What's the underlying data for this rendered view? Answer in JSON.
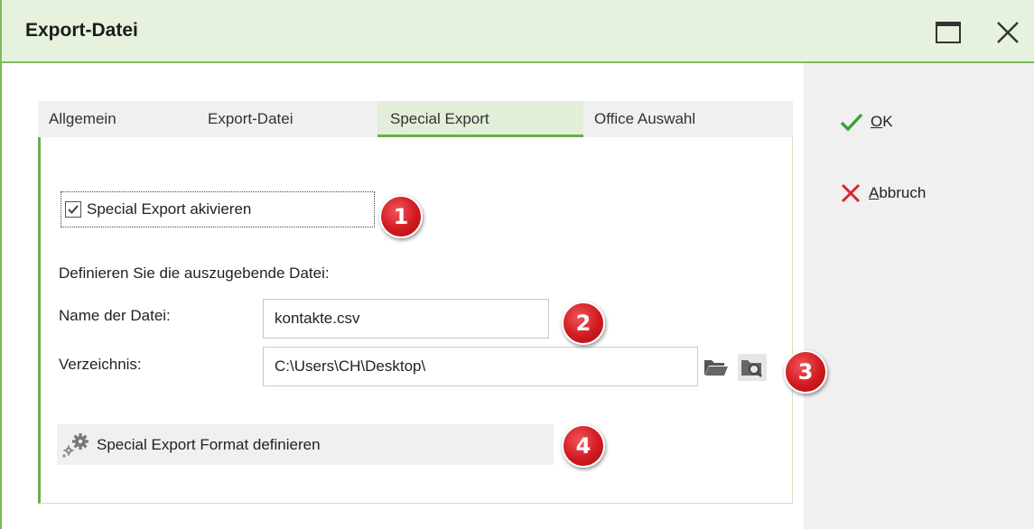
{
  "window": {
    "title": "Export-Datei",
    "maximize_icon": "maximize-icon",
    "close_icon": "close-icon"
  },
  "tabs": [
    {
      "label": "Allgemein",
      "active": false
    },
    {
      "label": "Export-Datei",
      "active": false
    },
    {
      "label": "Special Export",
      "active": true
    },
    {
      "label": "Office Auswahl",
      "active": false
    }
  ],
  "special_export": {
    "checkbox_label": "Special Export akivieren",
    "checkbox_checked": true,
    "define_text": "Definieren Sie die auszugebende Datei:",
    "name_label": "Name der Datei:",
    "name_value": "kontakte.csv",
    "dir_label": "Verzeichnis:",
    "dir_value": "C:\\Users\\CH\\Desktop\\",
    "format_button_label": "Special Export Format definieren"
  },
  "actions": {
    "ok_mnemonic": "O",
    "ok_rest": "K",
    "cancel_mnemonic": "A",
    "cancel_rest": "bbruch"
  },
  "markers": [
    "1",
    "2",
    "3",
    "4"
  ],
  "colors": {
    "accent_green": "#6aad4b",
    "title_bg": "#e6f2dd",
    "marker_red": "#d11a1f"
  }
}
